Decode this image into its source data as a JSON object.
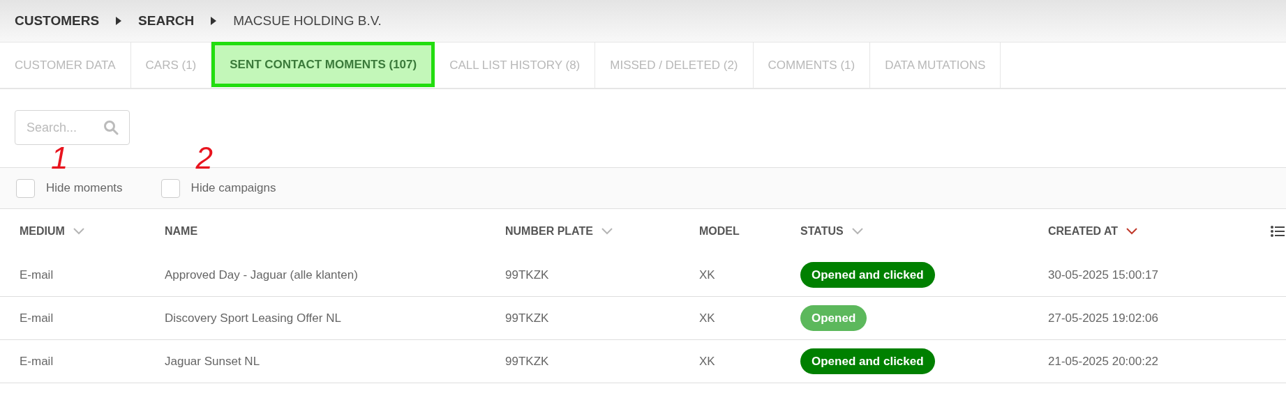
{
  "breadcrumb": [
    {
      "label": "CUSTOMERS",
      "current": false
    },
    {
      "label": "SEARCH",
      "current": false
    },
    {
      "label": "MACSUE HOLDING B.V.",
      "current": true
    }
  ],
  "tabs": [
    {
      "label": "CUSTOMER DATA",
      "selected": false
    },
    {
      "label": "CARS (1)",
      "selected": false
    },
    {
      "label": "SENT CONTACT MOMENTS (107)",
      "selected": true
    },
    {
      "label": "CALL LIST HISTORY (8)",
      "selected": false
    },
    {
      "label": "MISSED / DELETED (2)",
      "selected": false
    },
    {
      "label": "COMMENTS (1)",
      "selected": false
    },
    {
      "label": "DATA MUTATIONS",
      "selected": false
    }
  ],
  "search": {
    "placeholder": "Search..."
  },
  "filters": [
    {
      "label": "Hide moments",
      "checked": false,
      "annotation": "1"
    },
    {
      "label": "Hide campaigns",
      "checked": false,
      "annotation": "2"
    }
  ],
  "table": {
    "columns": [
      {
        "label": "MEDIUM",
        "sortable": true,
        "sorted": false
      },
      {
        "label": "NAME",
        "sortable": false
      },
      {
        "label": "NUMBER PLATE",
        "sortable": true,
        "sorted": false
      },
      {
        "label": "MODEL",
        "sortable": false
      },
      {
        "label": "STATUS",
        "sortable": true,
        "sorted": false
      },
      {
        "label": "CREATED AT",
        "sortable": true,
        "sorted": true
      }
    ],
    "rows": [
      {
        "medium": "E-mail",
        "name": "Approved Day - Jaguar (alle klanten)",
        "plate": "99TKZK",
        "model": "XK",
        "status": {
          "label": "Opened and clicked",
          "color": "#008000"
        },
        "created": "30-05-2025 15:00:17"
      },
      {
        "medium": "E-mail",
        "name": "Discovery Sport Leasing Offer NL",
        "plate": "99TKZK",
        "model": "XK",
        "status": {
          "label": "Opened",
          "color": "#5cb85c"
        },
        "created": "27-05-2025 19:02:06"
      },
      {
        "medium": "E-mail",
        "name": "Jaguar Sunset NL",
        "plate": "99TKZK",
        "model": "XK",
        "status": {
          "label": "Opened and clicked",
          "color": "#008000"
        },
        "created": "21-05-2025 20:00:22"
      }
    ]
  }
}
